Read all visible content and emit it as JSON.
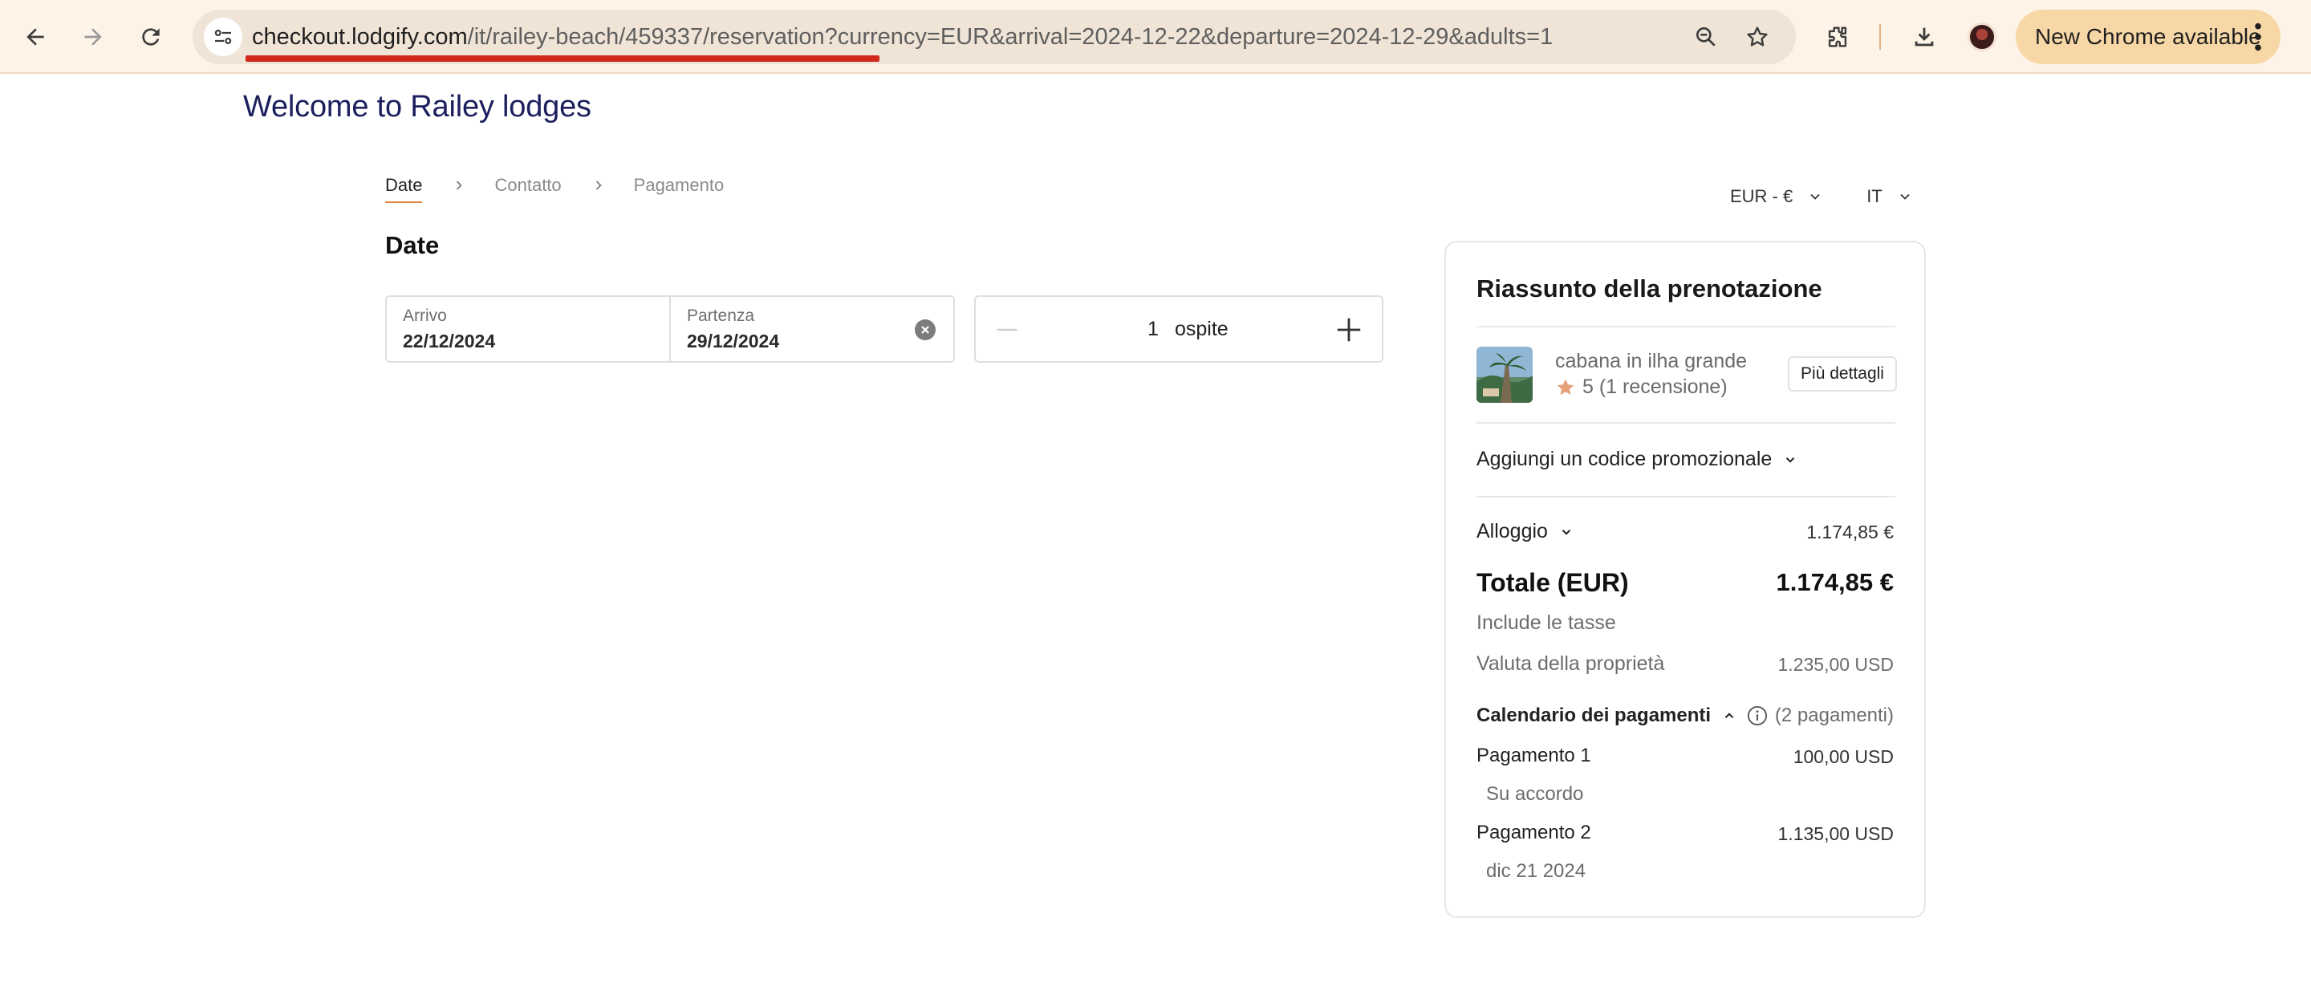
{
  "browser": {
    "url_host": "checkout.lodgify.com",
    "url_path": "/it/railey-beach/459337/reservation?currency=EUR&arrival=2024-12-22&departure=2024-12-29&adults=1",
    "update_label": "New Chrome available",
    "icons": [
      "back-arrow-icon",
      "forward-arrow-icon",
      "reload-icon",
      "site-settings-icon",
      "zoom-icon",
      "bookmark-star-icon",
      "extensions-icon",
      "download-icon",
      "profile-avatar",
      "more-vert-icon"
    ],
    "colors": {
      "toolbar_bg": "#fdf3e7",
      "omnibox_bg": "#efe4d6",
      "update_pill": "#f8d7a6",
      "url_underline": "#d2281c"
    }
  },
  "header": {
    "welcome": "Welcome to Railey lodges"
  },
  "steps": [
    {
      "label": "Date",
      "active": true
    },
    {
      "label": "Contatto",
      "active": false
    },
    {
      "label": "Pagamento",
      "active": false
    }
  ],
  "selectors": {
    "currency": "EUR - €",
    "language": "IT"
  },
  "dates": {
    "section_title": "Date",
    "arrival_label": "Arrivo",
    "arrival_value": "22/12/2024",
    "departure_label": "Partenza",
    "departure_value": "29/12/2024"
  },
  "guests": {
    "count": "1",
    "unit": "ospite"
  },
  "summary": {
    "title": "Riassunto della prenotazione",
    "property_name": "cabana in ilha grande",
    "rating": "5 (1 recensione)",
    "details_button": "Più dettagli",
    "promo_label": "Aggiungi un codice promozionale",
    "accommodation_label": "Alloggio",
    "accommodation_value": "1.174,85 €",
    "total_label": "Totale (EUR)",
    "total_value": "1.174,85 €",
    "taxes_note": "Include le tasse",
    "property_currency_label": "Valuta della proprietà",
    "property_currency_value": "1.235,00 USD",
    "schedule_label": "Calendario dei pagamenti",
    "schedule_count": "(2 pagamenti)",
    "payments": [
      {
        "label": "Pagamento 1",
        "amount": "100,00 USD",
        "when": "Su accordo"
      },
      {
        "label": "Pagamento 2",
        "amount": "1.135,00 USD",
        "when": "dic 21 2024"
      }
    ],
    "colors": {
      "accent": "#e0813c",
      "title_navy": "#1c1f5e",
      "star": "#e5a07a"
    }
  }
}
